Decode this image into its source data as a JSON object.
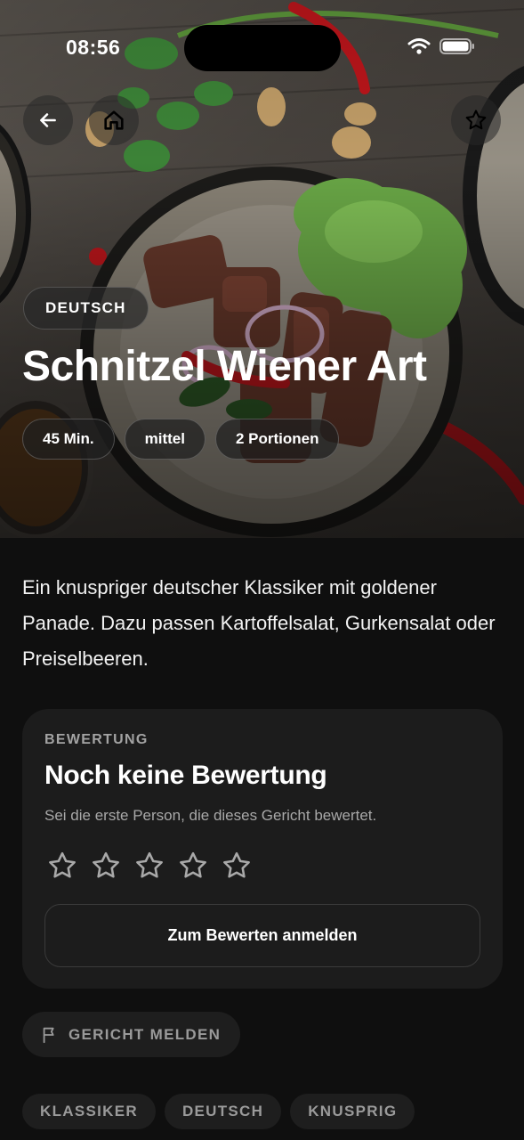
{
  "status_bar": {
    "time": "08:56"
  },
  "nav": {
    "back_icon": "arrow-left-icon",
    "home_icon": "home-icon",
    "favorite_icon": "star-outline-icon"
  },
  "hero": {
    "cuisine": "DEUTSCH",
    "title": "Schnitzel Wiener Art",
    "meta": [
      "45 Min.",
      "mittel",
      "2 Portionen"
    ]
  },
  "description": "Ein knuspriger deutscher Klassiker mit goldener Panade. Dazu passen Kartoffelsalat, Gurkensalat oder Preiselbeeren.",
  "rating": {
    "eyebrow": "BEWERTUNG",
    "title": "Noch keine Bewertung",
    "subtitle": "Sei die erste Person, die dieses Gericht bewertet.",
    "stars_filled": 0,
    "stars_total": 5,
    "login_label": "Zum Bewerten anmelden"
  },
  "report": {
    "label": "GERICHT MELDEN",
    "icon": "flag-icon"
  },
  "tags": [
    "KLASSIKER",
    "DEUTSCH",
    "KNUSPRIG"
  ],
  "colors": {
    "background": "#0f0f0f",
    "card": "#1c1c1c",
    "chip": "#1e1e1e",
    "muted_text": "#9a9a9a"
  }
}
